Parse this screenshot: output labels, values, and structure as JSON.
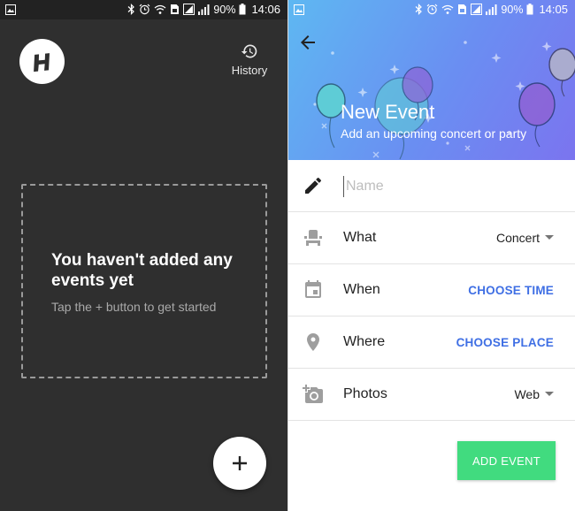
{
  "left": {
    "status": {
      "battery": "90%",
      "time": "14:06"
    },
    "history_label": "History",
    "empty_title": "You haven't added any events yet",
    "empty_subtitle": "Tap the + button to get started",
    "fab_label": "+"
  },
  "right": {
    "status": {
      "battery": "90%",
      "time": "14:05"
    },
    "header": {
      "title": "New Event",
      "subtitle": "Add an upcoming concert or party"
    },
    "form": {
      "name_placeholder": "Name",
      "what": {
        "label": "What",
        "value": "Concert"
      },
      "when": {
        "label": "When",
        "action": "CHOOSE TIME"
      },
      "where": {
        "label": "Where",
        "action": "CHOOSE PLACE"
      },
      "photos": {
        "label": "Photos",
        "value": "Web"
      }
    },
    "add_button": "ADD EVENT"
  },
  "icons": {
    "gallery": "image-icon",
    "bluetooth": "bluetooth-icon",
    "alarm": "alarm-icon",
    "wifi": "wifi-icon",
    "signal": "signal-icon",
    "battery": "battery-icon",
    "history": "history-icon",
    "pencil": "pencil-icon",
    "seat": "seat-icon",
    "calendar": "calendar-icon",
    "place": "place-icon",
    "add_photo": "add-photo-icon",
    "back": "back-arrow-icon"
  },
  "colors": {
    "dark_background": "#2f2f2f",
    "accent_link": "#3f6fe4",
    "add_button": "#41db7f",
    "header_gradient_start": "#5eb8f2",
    "header_gradient_end": "#7b74ef"
  }
}
